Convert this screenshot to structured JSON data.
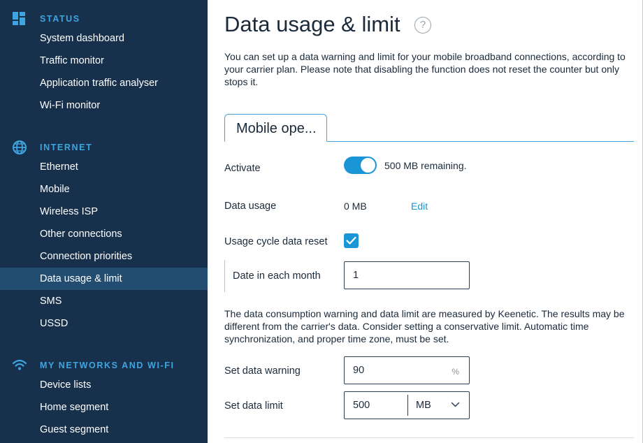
{
  "sidebar": {
    "sections": [
      {
        "title": "STATUS",
        "icon": "dashboard-icon",
        "items": [
          "System dashboard",
          "Traffic monitor",
          "Application traffic analyser",
          "Wi-Fi monitor"
        ]
      },
      {
        "title": "INTERNET",
        "icon": "globe-icon",
        "items": [
          "Ethernet",
          "Mobile",
          "Wireless ISP",
          "Other connections",
          "Connection priorities",
          "Data usage & limit",
          "SMS",
          "USSD"
        ]
      },
      {
        "title": "MY NETWORKS AND WI-FI",
        "icon": "wifi-icon",
        "items": [
          "Device lists",
          "Home segment",
          "Guest segment"
        ]
      }
    ],
    "active_item": "Data usage & limit"
  },
  "main": {
    "title": "Data usage & limit",
    "help_glyph": "?",
    "intro": "You can set up a data warning and limit for your mobile broadband connections, according to your carrier plan. Please note that disabling the function does not reset the counter but only stops it.",
    "tab": "Mobile ope...",
    "activate": {
      "label": "Activate",
      "enabled": true,
      "status": "500 MB remaining."
    },
    "data_usage": {
      "label": "Data usage",
      "value": "0 MB",
      "edit": "Edit"
    },
    "cycle_reset": {
      "label": "Usage cycle data reset",
      "checked": true
    },
    "date_each_month": {
      "label": "Date in each month",
      "value": "1"
    },
    "note": "The data consumption warning and data limit are measured by Keenetic. The results may be different from the carrier's data. Consider setting a conservative limit. Automatic time synchronization, and proper time zone, must be set.",
    "data_warning": {
      "label": "Set data warning",
      "value": "90",
      "unit": "%"
    },
    "data_limit": {
      "label": "Set data limit",
      "value": "500",
      "unit": "MB"
    }
  },
  "colors": {
    "sidebar_bg": "#17314d",
    "sidebar_active": "#234c71",
    "section_title": "#3ea5e0",
    "accent": "#1a96d6"
  }
}
